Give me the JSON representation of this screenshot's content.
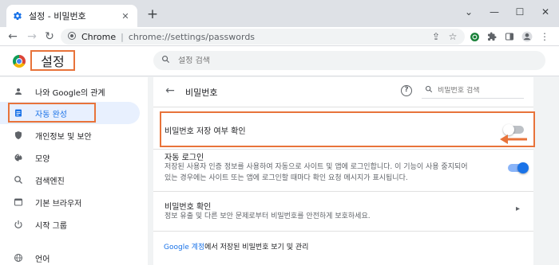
{
  "browser": {
    "tab_title": "설정 - 비밀번호",
    "tab_close": "✕",
    "new_tab": "+",
    "window_controls": [
      "⌄",
      "—",
      "☐",
      "✕"
    ],
    "origin": "Chrome",
    "separator": "|",
    "url": "chrome://settings/passwords"
  },
  "header": {
    "title": "설정",
    "search_placeholder": "설정 검색"
  },
  "sidebar": {
    "items": [
      {
        "label": "나와 Google의 관계",
        "icon": "person-icon"
      },
      {
        "label": "자동 완성",
        "icon": "assignment-icon",
        "active": true
      },
      {
        "label": "개인정보 및 보안",
        "icon": "shield-icon"
      },
      {
        "label": "모양",
        "icon": "palette-icon"
      },
      {
        "label": "검색엔진",
        "icon": "search-icon"
      },
      {
        "label": "기본 브라우저",
        "icon": "browser-icon"
      },
      {
        "label": "시작 그룹",
        "icon": "power-icon"
      },
      {
        "label": "언어",
        "icon": "globe-icon"
      }
    ]
  },
  "main": {
    "page_title": "비밀번호",
    "password_search_placeholder": "비밀번호 검색",
    "offer_to_save": {
      "label": "비밀번호 저장 여부 확인",
      "enabled": false
    },
    "auto_signin": {
      "label": "자동 로그인",
      "description_line1": "저장된 사용자 인증 정보를 사용하여 자동으로 사이트 및 앱에 로그인합니다. 이 기능이 사용 중지되어",
      "description_line2": "있는 경우에는 사이트 또는 앱에 로그인할 때마다 확인 요청 메시지가 표시됩니다.",
      "enabled": true
    },
    "check_passwords": {
      "label": "비밀번호 확인",
      "description": "정보 유출 및 다른 보안 문제로부터 비밀번호를 안전하게 보호하세요."
    },
    "manage": {
      "link_text": "Google 계정",
      "rest_text": "에서 저장된 비밀번호 보기 및 관리"
    }
  },
  "colors": {
    "accent": "#1a73e8",
    "highlight_box": "#e8733a"
  }
}
